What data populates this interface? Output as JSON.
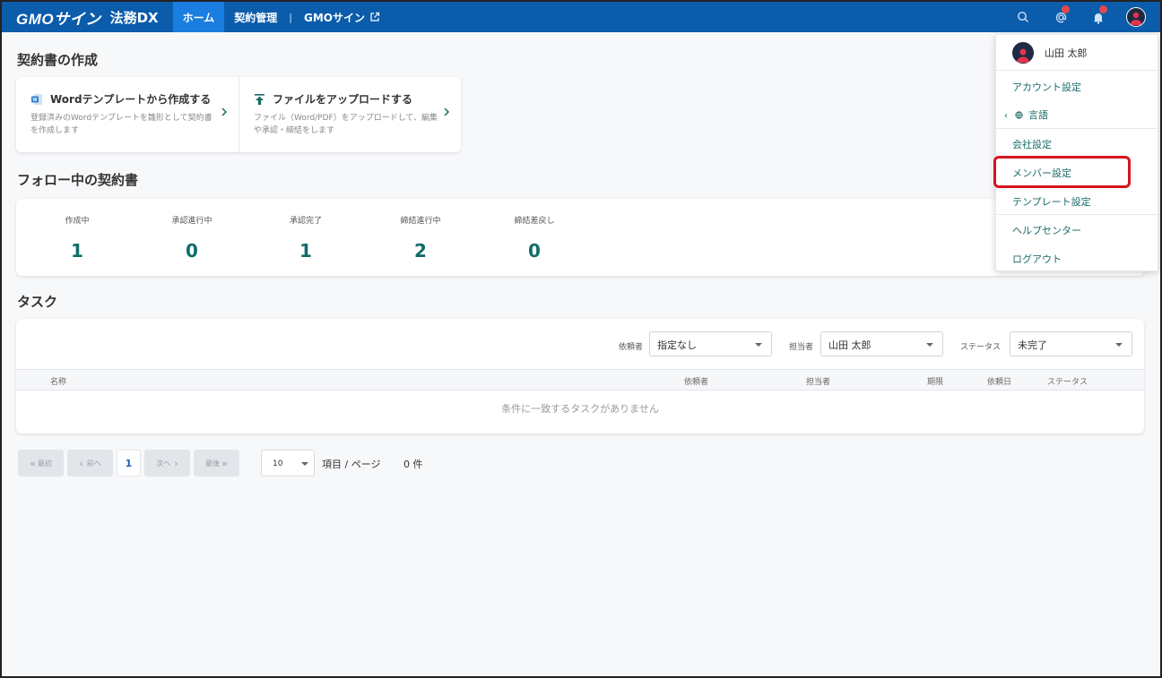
{
  "header": {
    "logo_brand": "GMOサイン",
    "logo_product": "法務DX",
    "nav": [
      {
        "label": "ホーム",
        "active": true
      },
      {
        "label": "契約管理",
        "active": false
      },
      {
        "label": "GMOサイン",
        "active": false,
        "external": true
      }
    ],
    "nav_separator": "|",
    "icons": [
      "search-icon",
      "mention-icon",
      "bell-icon",
      "user-avatar-icon"
    ],
    "accent_color": "#0b5cab"
  },
  "create_section": {
    "title": "契約書の作成",
    "items": [
      {
        "title": "Wordテンプレートから作成する",
        "desc": "登録済みのWordテンプレートを雛形として契約書を作成します",
        "icon": "word-icon"
      },
      {
        "title": "ファイルをアップロードする",
        "desc": "ファイル（Word/PDF）をアップロードして、編集や承認・締結をします",
        "icon": "upload-icon"
      }
    ]
  },
  "follow_section": {
    "title": "フォロー中の契約書",
    "stats": [
      {
        "label": "作成中",
        "value": "1"
      },
      {
        "label": "承認進行中",
        "value": "0"
      },
      {
        "label": "承認完了",
        "value": "1"
      },
      {
        "label": "締結進行中",
        "value": "2"
      },
      {
        "label": "締結差戻し",
        "value": "0"
      }
    ]
  },
  "task_section": {
    "title": "タスク",
    "filters": {
      "requester_label": "依頼者",
      "requester_value": "指定なし",
      "assignee_label": "担当者",
      "assignee_value": "山田 太郎",
      "status_label": "ステータス",
      "status_value": "未完了"
    },
    "columns": [
      "名称",
      "依頼者",
      "担当者",
      "期限",
      "依頼日",
      "ステータス"
    ],
    "empty_message": "条件に一致するタスクがありません"
  },
  "pagination": {
    "first": "最初",
    "prev": "前へ",
    "current": "1",
    "next": "次へ",
    "last": "最後",
    "per_page": "10",
    "per_page_suffix": "項目 / ページ",
    "count": "0 件"
  },
  "user_menu": {
    "username": "山田 太郎",
    "items": [
      {
        "label": "アカウント設定"
      },
      {
        "label": "言語"
      },
      {
        "label": "会社設定"
      },
      {
        "label": "メンバー設定",
        "highlighted": true
      },
      {
        "label": "テンプレート設定"
      },
      {
        "label": "ヘルプセンター"
      },
      {
        "label": "ログアウト"
      }
    ],
    "highlight_color": "#d8141b"
  }
}
